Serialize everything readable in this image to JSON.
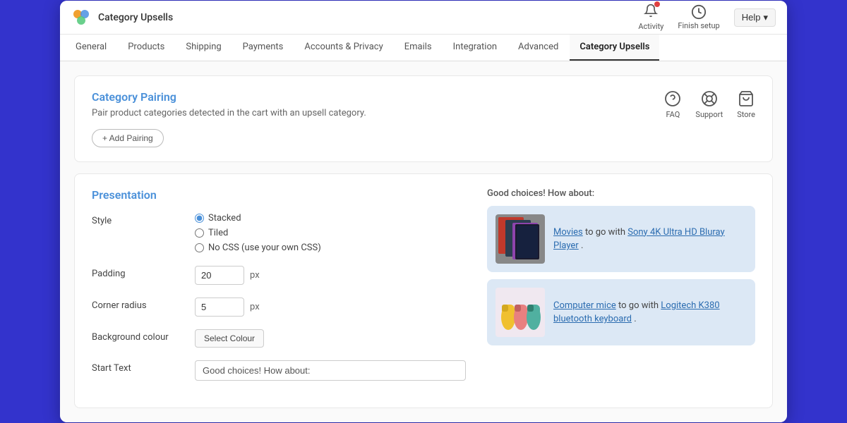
{
  "app": {
    "title": "Category Upsells",
    "logo_alt": "app-logo"
  },
  "topbar": {
    "activity_label": "Activity",
    "finish_setup_label": "Finish setup",
    "help_label": "Help"
  },
  "nav": {
    "tabs": [
      {
        "id": "general",
        "label": "General",
        "active": false
      },
      {
        "id": "products",
        "label": "Products",
        "active": false
      },
      {
        "id": "shipping",
        "label": "Shipping",
        "active": false
      },
      {
        "id": "payments",
        "label": "Payments",
        "active": false
      },
      {
        "id": "accounts-privacy",
        "label": "Accounts & Privacy",
        "active": false
      },
      {
        "id": "emails",
        "label": "Emails",
        "active": false
      },
      {
        "id": "integration",
        "label": "Integration",
        "active": false
      },
      {
        "id": "advanced",
        "label": "Advanced",
        "active": false
      },
      {
        "id": "category-upsells",
        "label": "Category Upsells",
        "active": true
      }
    ]
  },
  "category_pairing": {
    "title": "Category Pairing",
    "description": "Pair product categories detected in the cart with an upsell category.",
    "add_pairing_label": "+ Add Pairing",
    "faq_label": "FAQ",
    "support_label": "Support",
    "store_label": "Store"
  },
  "presentation": {
    "title": "Presentation",
    "style_label": "Style",
    "style_options": [
      {
        "id": "stacked",
        "label": "Stacked",
        "checked": true
      },
      {
        "id": "tiled",
        "label": "Tiled",
        "checked": false
      },
      {
        "id": "no-css",
        "label": "No CSS (use your own CSS)",
        "checked": false
      }
    ],
    "padding_label": "Padding",
    "padding_value": "20",
    "padding_unit": "px",
    "corner_radius_label": "Corner radius",
    "corner_radius_value": "5",
    "corner_radius_unit": "px",
    "background_colour_label": "Background colour",
    "select_colour_label": "Select Colour",
    "start_text_label": "Start Text",
    "start_text_value": "Good choices! How about:"
  },
  "preview": {
    "header_text": "Good choices! How about:",
    "cards": [
      {
        "text_prefix": "Movies",
        "text_middle": " to go with ",
        "text_link": "Sony 4K Ultra HD Bluray Player",
        "text_suffix": ".",
        "prefix_is_link": true,
        "bg": "#d6e8f7"
      },
      {
        "text_prefix": "Computer mice",
        "text_middle": " to go with ",
        "text_link": "Logitech K380 bluetooth keyboard",
        "text_suffix": ".",
        "prefix_is_link": true,
        "bg": "#d6e8f7"
      }
    ]
  }
}
